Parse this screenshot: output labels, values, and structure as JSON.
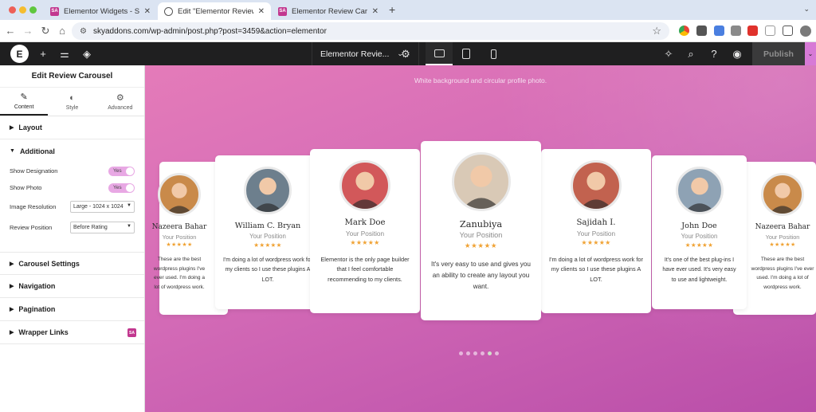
{
  "browser": {
    "tabs": [
      {
        "label": "Elementor Widgets - Sky Addons",
        "favicon": "sa"
      },
      {
        "label": "Edit \"Elementor Review Carousel\"",
        "favicon": "globe"
      },
      {
        "label": "Elementor Review Carousel W",
        "favicon": "sa"
      }
    ],
    "url": "skyaddons.com/wp-admin/post.php?post=3459&action=elementor"
  },
  "editor": {
    "page_title": "Elementor Revie...",
    "publish_label": "Publish"
  },
  "panel": {
    "title": "Edit Review Carousel",
    "tabs": [
      {
        "label": "Content",
        "icon": "pencil-icon"
      },
      {
        "label": "Style",
        "icon": "contrast-icon"
      },
      {
        "label": "Advanced",
        "icon": "gear-icon"
      }
    ],
    "sections": {
      "layout": "Layout",
      "additional": "Additional",
      "carousel_settings": "Carousel Settings",
      "navigation": "Navigation",
      "pagination": "Pagination",
      "wrapper_links": "Wrapper Links"
    },
    "controls": {
      "show_designation": {
        "label": "Show Designation",
        "value": "Yes"
      },
      "show_photo": {
        "label": "Show Photo",
        "value": "Yes"
      },
      "image_resolution": {
        "label": "Image Resolution",
        "value": "Large - 1024 x 1024"
      },
      "review_position": {
        "label": "Review Position",
        "value": "Before Rating"
      }
    }
  },
  "canvas": {
    "subtitle": "White background and circular profile photo.",
    "stars": "★★★★★",
    "cards": [
      {
        "name": "Nazeera Bahar",
        "position": "Your Position",
        "review": "These are the best wordpress plugins I've ever used. I'm doing a lot of wordpress work.",
        "avatar_color": "#c98a4a"
      },
      {
        "name": "William C. Bryan",
        "position": "Your Position",
        "review": "I'm doing a lot of wordpress work for my clients so I use these plugins A LOT.",
        "avatar_color": "#6d7f8d"
      },
      {
        "name": "Mark Doe",
        "position": "Your Position",
        "review": "Elementor is the only page builder that I feel comfortable recommending to my clients.",
        "avatar_color": "#d2585a"
      },
      {
        "name": "Zanubiya",
        "position": "Your Position",
        "review": "It's very easy to use and gives you an ability to create any layout you want.",
        "avatar_color": "#d9c9b6"
      },
      {
        "name": "Sajidah I.",
        "position": "Your Position",
        "review": "I'm doing a lot of wordpress work for my clients so I use these plugins A LOT.",
        "avatar_color": "#c2624f"
      },
      {
        "name": "John Doe",
        "position": "Your Position",
        "review": "It's one of the best plug-ins I have ever used. It's very easy to use and lightweight.",
        "avatar_color": "#8ea2b4"
      },
      {
        "name": "Nazeera Bahar",
        "position": "Your Position",
        "review": "These are the best wordpress plugins I've ever used. I'm doing a lot of wordpress work.",
        "avatar_color": "#c98a4a"
      }
    ],
    "pagination": {
      "count": 6,
      "active": 4
    }
  }
}
